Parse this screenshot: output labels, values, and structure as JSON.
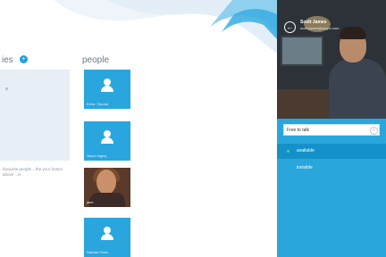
{
  "favorites": {
    "heading": "ies",
    "add_icon": "plus-icon",
    "hint": "favourite people ...the your button above ...is"
  },
  "people": {
    "heading": "people",
    "contacts": [
      {
        "name": "Echo / Sound",
        "kind": "avatar"
      },
      {
        "name": "Jason Ingley",
        "kind": "avatar"
      },
      {
        "name": "jane",
        "kind": "photo"
      },
      {
        "name": "Damian Sock",
        "kind": "avatar"
      }
    ]
  },
  "panel": {
    "back_icon": "back-arrow-icon",
    "contact_name": "Scott James",
    "contact_sub": "scott.james@skype.com",
    "mood_message": "Free to talk",
    "clear_icon": "close-icon",
    "statuses": [
      {
        "label": "available",
        "selected": true,
        "color": "#2fe08a"
      },
      {
        "label": "invisible",
        "selected": false
      }
    ]
  },
  "colors": {
    "accent": "#29a6dc",
    "tile": "#2aa6de",
    "selected_row": "#1591c9"
  }
}
